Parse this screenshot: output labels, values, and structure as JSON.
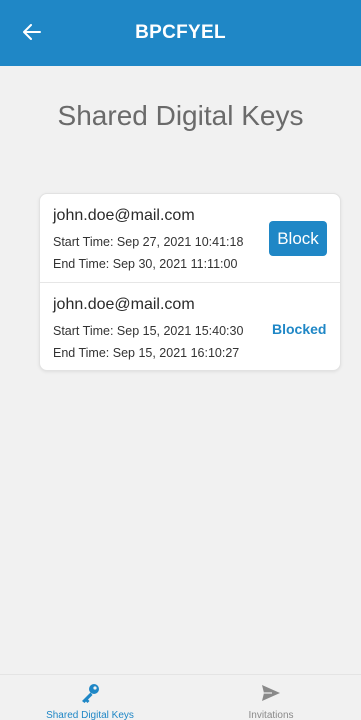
{
  "app_bar": {
    "title": "BPCFYEL",
    "back_icon": "arrow-left-icon",
    "background_color": "#1f87c6"
  },
  "page": {
    "title": "Shared Digital Keys"
  },
  "keys": [
    {
      "email": "john.doe@mail.com",
      "start_time": "Start Time: Sep 27, 2021 10:41:18",
      "end_time": "End Time: Sep 30, 2021 11:11:00",
      "action_label": "Block"
    },
    {
      "email": "john.doe@mail.com",
      "start_time": "Start Time: Sep 15, 2021 15:40:30",
      "end_time": "End Time: Sep 15, 2021 16:10:27",
      "status_label": "Blocked"
    }
  ],
  "bottom_nav": {
    "items": [
      {
        "label": "Shared Digital Keys",
        "icon": "key-icon",
        "active": true
      },
      {
        "label": "Invitations",
        "icon": "send-icon",
        "active": false
      }
    ]
  },
  "colors": {
    "accent": "#1f87c6",
    "background": "#f1f1f1",
    "inactive": "#8a8a8a"
  }
}
